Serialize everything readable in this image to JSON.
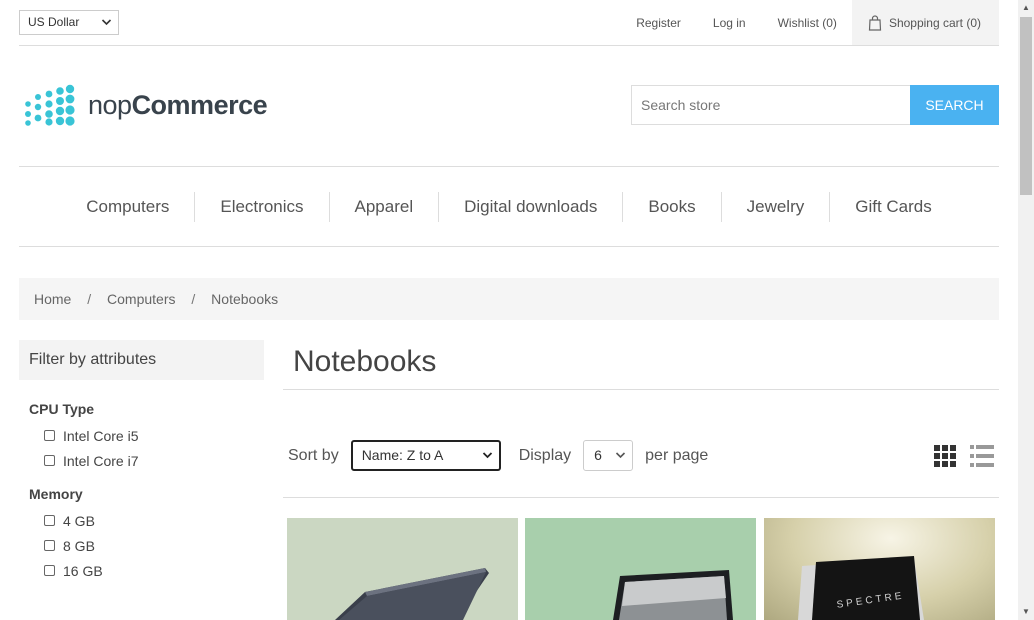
{
  "header": {
    "currency": "US Dollar",
    "links": [
      "Register",
      "Log in",
      "Wishlist (0)"
    ],
    "cart": "Shopping cart (0)"
  },
  "logo": {
    "text_light": "nop",
    "text_bold": "Commerce"
  },
  "search": {
    "placeholder": "Search store",
    "button": "SEARCH"
  },
  "menu": [
    "Computers",
    "Electronics",
    "Apparel",
    "Digital downloads",
    "Books",
    "Jewelry",
    "Gift Cards"
  ],
  "breadcrumb": [
    "Home",
    "Computers",
    "Notebooks"
  ],
  "breadcrumb_separator": "/",
  "filters": {
    "title": "Filter by attributes",
    "groups": [
      {
        "title": "CPU Type",
        "options": [
          "Intel Core i5",
          "Intel Core i7"
        ]
      },
      {
        "title": "Memory",
        "options": [
          "4 GB",
          "8 GB",
          "16 GB"
        ]
      }
    ]
  },
  "main": {
    "title": "Notebooks",
    "sort_label": "Sort by",
    "sort_value": "Name: Z to A",
    "display_label": "Display",
    "page_size": "6",
    "per_page_label": "per page",
    "product_brand_text": "SPECTRE"
  },
  "colors": {
    "accent": "#4ab2f1",
    "logo": "#39c4d6"
  }
}
